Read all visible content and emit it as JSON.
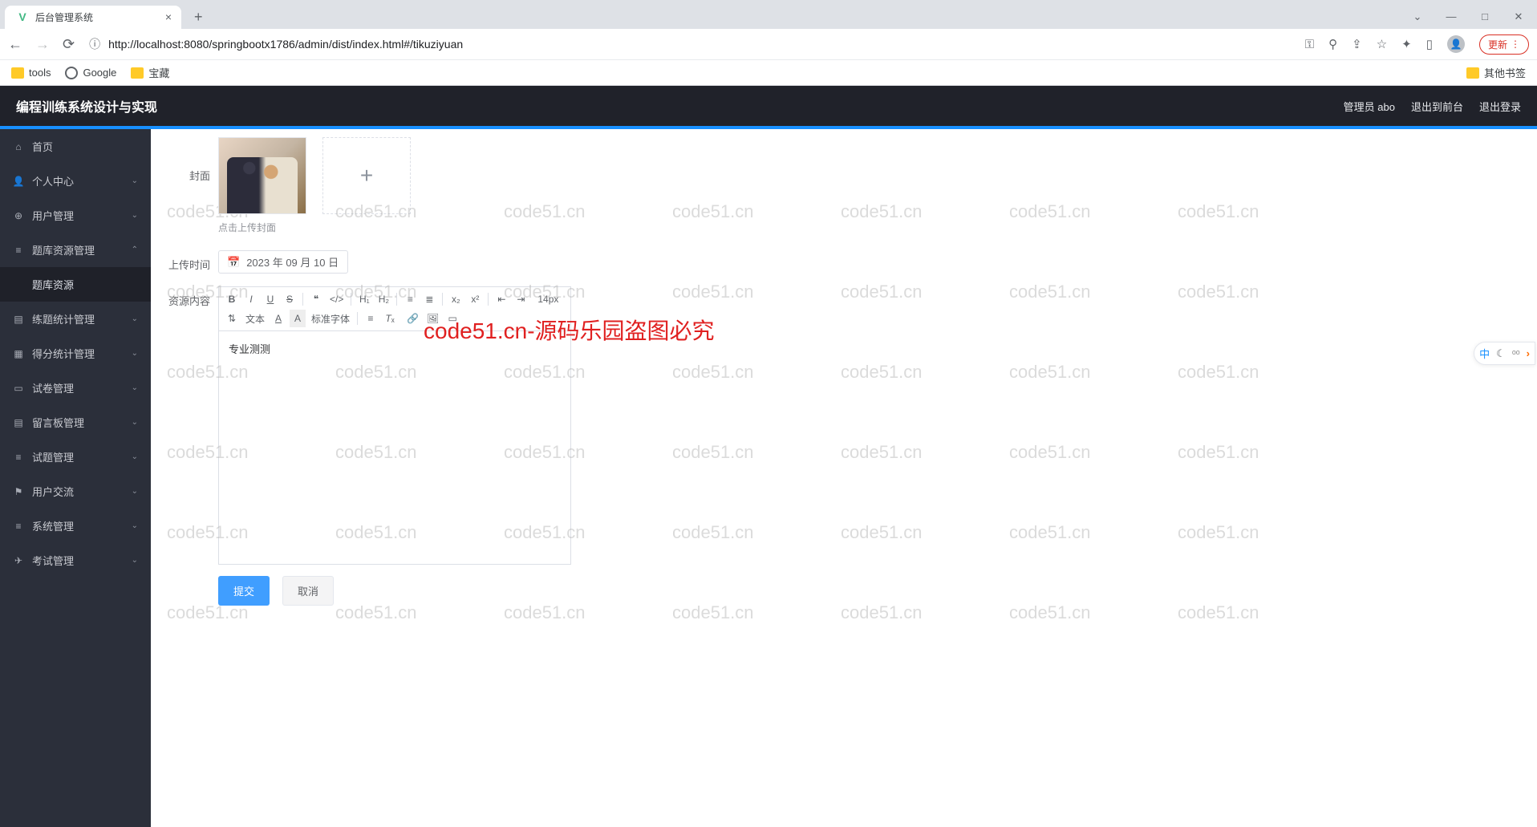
{
  "browser": {
    "tab_title": "后台管理系统",
    "url_display": "http://localhost:8080/springbootx1786/admin/dist/index.html#/tikuziyuan",
    "bookmarks": {
      "tools": "tools",
      "google": "Google",
      "treasure": "宝藏",
      "other": "其他书签"
    },
    "update_btn": "更新"
  },
  "header": {
    "title": "编程训练系统设计与实现",
    "user": "管理员 abo",
    "back_front": "退出到前台",
    "logout": "退出登录"
  },
  "sidebar": {
    "items": [
      {
        "label": "首页",
        "icon": "home",
        "expandable": false
      },
      {
        "label": "个人中心",
        "icon": "user",
        "expandable": true
      },
      {
        "label": "用户管理",
        "icon": "users",
        "expandable": true
      },
      {
        "label": "题库资源管理",
        "icon": "list",
        "expandable": true,
        "expanded": true,
        "sub": [
          {
            "label": "题库资源"
          }
        ]
      },
      {
        "label": "练题统计管理",
        "icon": "doc",
        "expandable": true
      },
      {
        "label": "得分统计管理",
        "icon": "score",
        "expandable": true
      },
      {
        "label": "试卷管理",
        "icon": "paper",
        "expandable": true
      },
      {
        "label": "留言板管理",
        "icon": "msg",
        "expandable": true
      },
      {
        "label": "试题管理",
        "icon": "list",
        "expandable": true
      },
      {
        "label": "用户交流",
        "icon": "flag",
        "expandable": true
      },
      {
        "label": "系统管理",
        "icon": "sys",
        "expandable": true
      },
      {
        "label": "考试管理",
        "icon": "exam",
        "expandable": true
      }
    ]
  },
  "form": {
    "cover_label": "封面",
    "cover_hint": "点击上传封面",
    "uploadtime_label": "上传时间",
    "uploadtime_value": "2023 年 09 月 10 日",
    "content_label": "资源内容",
    "editor_text": "专业测测",
    "toolbar": {
      "fontsize": "14px",
      "texttype": "文本",
      "fontfamily": "标准字体"
    },
    "submit": "提交",
    "cancel": "取消"
  },
  "overlay_red": "code51.cn-源码乐园盗图必究",
  "ime": {
    "lang": "中"
  },
  "watermark_text": "code51.cn"
}
